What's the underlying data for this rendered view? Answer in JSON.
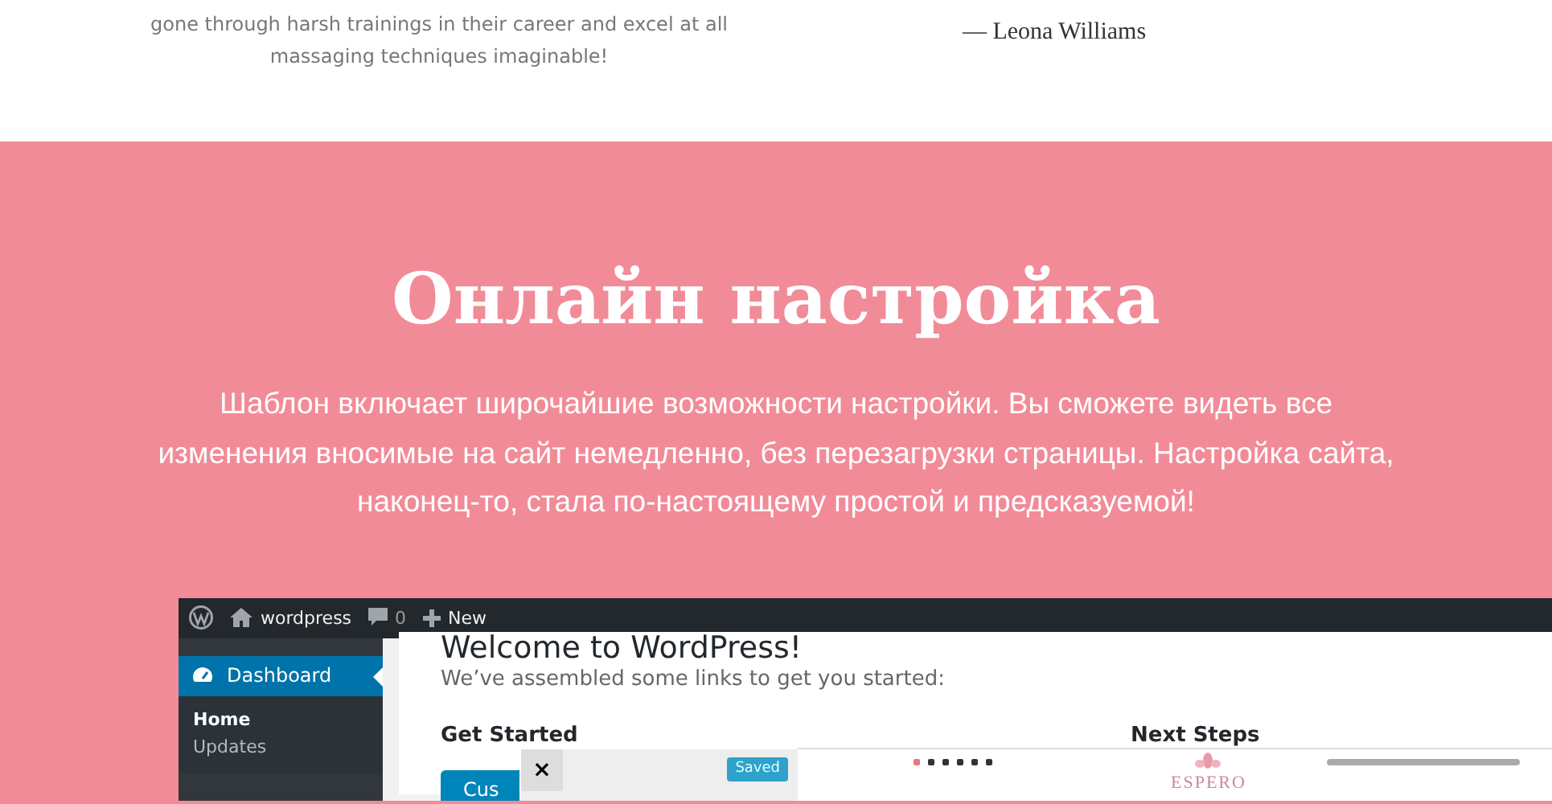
{
  "testimonial": {
    "text_lines": [
      "gone through harsh trainings in their career and excel at all",
      "massaging techniques imaginable!"
    ],
    "author": "— Leona Williams"
  },
  "hero": {
    "title": "Онлайн настройка",
    "text": "Шаблон включает широчайшие возможности настройки. Вы сможете видеть все изменения вносимые на сайт немедленно, без перезагрузки страницы. Настройка сайта, наконец-то, стала по-настоящему простой и предсказуемой!"
  },
  "screenshot": {
    "admin_bar": {
      "site": "wordpress",
      "comments": "0",
      "new": "New"
    },
    "menu": [
      {
        "label": "Dashboard",
        "selected": true,
        "children": [
          {
            "label": "Home",
            "selected": true
          },
          {
            "label": "Updates",
            "selected": false
          }
        ]
      }
    ],
    "welcome": {
      "title": "Welcome to WordPress!",
      "subtitle": "We’ve assembled some links to get you started:",
      "get_started": "Get Started",
      "next_steps": "Next Steps",
      "button": "Cus"
    },
    "customizer": {
      "close": "×",
      "status": "Saved"
    },
    "preview": {
      "logo": "ESPERO"
    }
  }
}
